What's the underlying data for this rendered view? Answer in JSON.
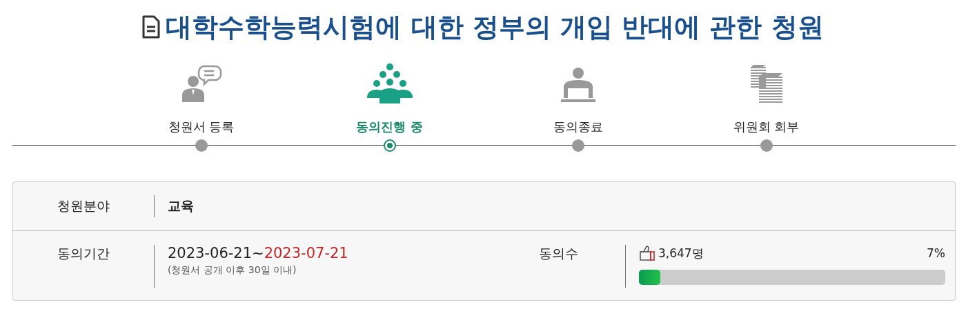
{
  "title": "대학수학능력시험에 대한 정부의 개입 반대에 관한 청원",
  "steps": [
    {
      "label": "청원서 등록",
      "selected": false
    },
    {
      "label": "동의진행 중",
      "selected": true
    },
    {
      "label": "동의종료",
      "selected": false
    },
    {
      "label": "위원회 회부",
      "selected": false
    }
  ],
  "info": {
    "field_label": "청원분야",
    "field_value": "교육",
    "period_label": "동의기간",
    "period_start": "2023-06-21~",
    "period_end": "2023-07-21",
    "period_note": "(청원서 공개 이후 30일 이내)",
    "agree_label": "동의수",
    "agree_count": "3,647명",
    "agree_percent": "7%",
    "level": 0.07
  }
}
